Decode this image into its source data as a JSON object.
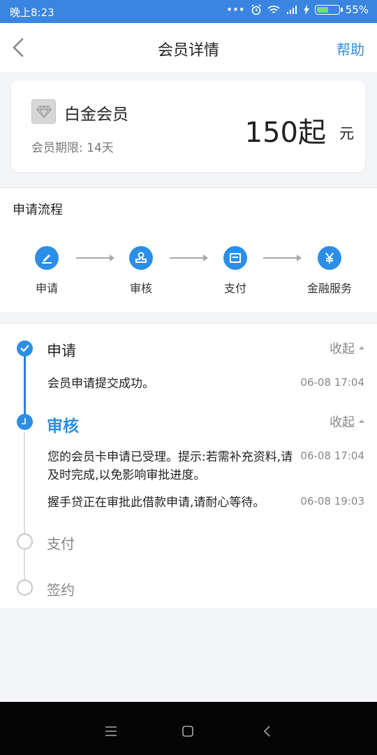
{
  "status_bar": {
    "time": "晚上8:23",
    "battery": "55%",
    "battery_level": 0.55
  },
  "nav": {
    "title": "会员详情",
    "help": "帮助"
  },
  "membership": {
    "level": "白金会员",
    "period": "会员期限: 14天",
    "price": "150起",
    "unit": "元"
  },
  "flow": {
    "title": "申请流程",
    "steps": [
      {
        "label": "申请",
        "icon": "pen-icon"
      },
      {
        "label": "审核",
        "icon": "stamp-icon"
      },
      {
        "label": "支付",
        "icon": "wallet-icon"
      },
      {
        "label": "金融服务",
        "icon": "yen-icon"
      }
    ]
  },
  "timeline": {
    "items": [
      {
        "title": "申请",
        "state": "done",
        "collapse": "收起",
        "entries": [
          {
            "text": "会员申请提交成功。",
            "time": "06-08 17:04"
          }
        ]
      },
      {
        "title": "审核",
        "state": "current",
        "collapse": "收起",
        "entries": [
          {
            "text": "您的会员卡申请已受理。提示:若需补充资料,请及时完成,以免影响审批进度。",
            "time": "06-08 17:04"
          },
          {
            "text": "握手贷正在审批此借款申请,请耐心等待。",
            "time": "06-08 19:03"
          }
        ]
      },
      {
        "title": "支付",
        "state": "pending"
      },
      {
        "title": "签约",
        "state": "pending"
      }
    ]
  },
  "colors": {
    "accent": "#2c8ee6",
    "status_bar": "#3a85df"
  }
}
